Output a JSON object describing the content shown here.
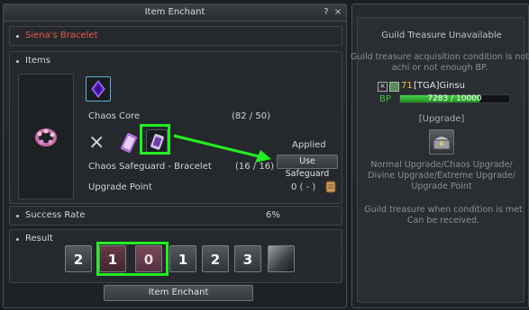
{
  "window": {
    "title": "Item Enchant",
    "help_label": "?",
    "close_label": "×"
  },
  "item": {
    "name": "Siena's Bracelet",
    "name_color": "#e8593f"
  },
  "items_section": {
    "heading": "Items",
    "chaos_core": {
      "label": "Chaos Core",
      "count": "(82 / 50)"
    },
    "safeguard": {
      "label": "Chaos Safeguard - Bracelet",
      "count": "(16 / 16)",
      "status": "Applied",
      "use_button": "Use Safeguard",
      "remove_icon": "×"
    },
    "upgrade_point": {
      "label": "Upgrade Point",
      "value": "0 ( - )"
    }
  },
  "success_rate": {
    "label": "Success Rate",
    "value": "6%"
  },
  "result": {
    "heading": "Result",
    "slots": [
      {
        "value": "2",
        "direction": "down"
      },
      {
        "value": "1",
        "direction": "down",
        "highlight": true
      },
      {
        "value": "0",
        "direction": "none",
        "highlight": true
      },
      {
        "value": "1",
        "direction": "up"
      },
      {
        "value": "2",
        "direction": "up"
      },
      {
        "value": "3",
        "direction": "up"
      }
    ]
  },
  "enchant_button": "Item Enchant",
  "guild_panel": {
    "title": "Guild Treasure Unavailable",
    "description": "Guild treasure acquisition condition is not achi or not enough BP.",
    "member": {
      "level": "71",
      "name": "[TGA]Ginsu",
      "bp_label": "BP",
      "bp_text": "7283 / 10000",
      "bp_fraction": 0.7283
    },
    "upgrade_heading": "[Upgrade]",
    "upgrade_types": "Normal Upgrade/Chaos Upgrade/ Divine Upgrade/Extreme Upgrade/ Upgrade Point",
    "footer": "Guild treasure when condition is met Can be received."
  },
  "colors": {
    "highlight": "#22ee22",
    "bp_bar": "#3cc43c",
    "level": "#f0c030"
  },
  "icons": {
    "chaos_core": "purple-crystal-icon",
    "safeguard_scroll": "scroll-icon",
    "chest": "treasure-chest-icon"
  }
}
